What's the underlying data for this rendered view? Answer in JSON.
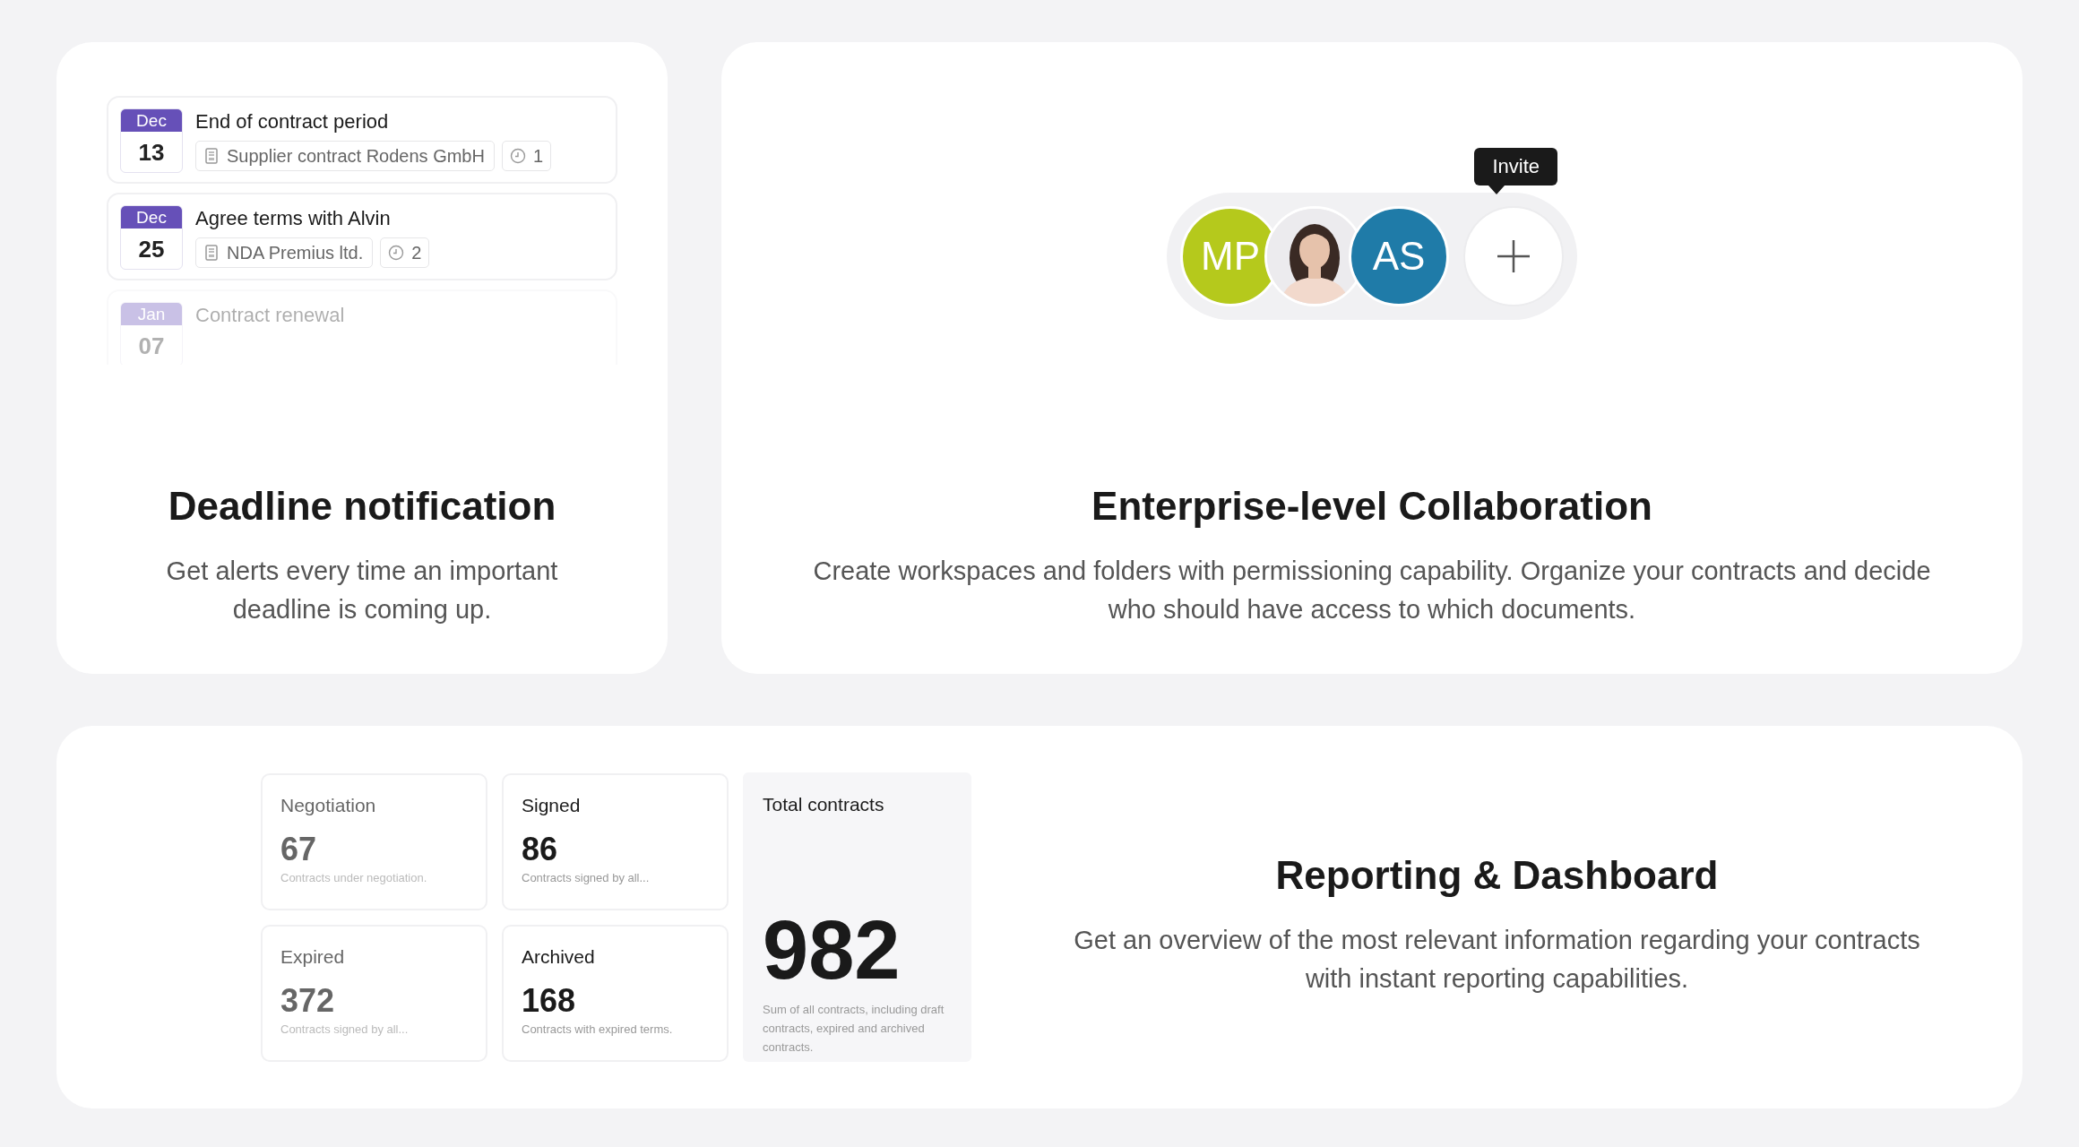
{
  "deadline_card": {
    "events": [
      {
        "month": "Dec",
        "day": "13",
        "title": "End of contract period",
        "document": "Supplier contract Rodens GmbH",
        "reminders": "1",
        "faded": false
      },
      {
        "month": "Dec",
        "day": "25",
        "title": "Agree terms with Alvin",
        "document": "NDA Premius ltd.",
        "reminders": "2",
        "faded": false
      },
      {
        "month": "Jan",
        "day": "07",
        "title": "Contract renewal",
        "faded": true
      }
    ],
    "title": "Deadline notification",
    "description": "Get alerts every time an important deadline is coming up."
  },
  "collaboration_card": {
    "avatars": [
      {
        "kind": "initials",
        "initials": "MP",
        "color": "#b5c91c"
      },
      {
        "kind": "picture"
      },
      {
        "kind": "initials",
        "initials": "AS",
        "color": "#1f7ba8"
      }
    ],
    "invite_tooltip": "Invite",
    "title": "Enterprise-level Collaboration",
    "description": "Create workspaces and folders with permissioning capability. Organize your contracts and decide who should have access to which documents."
  },
  "reporting_card": {
    "stats": [
      {
        "label": "Negotiation",
        "value": "67",
        "caption": "Contracts under negotiation.",
        "dimmed": true
      },
      {
        "label": "Signed",
        "value": "86",
        "caption": "Contracts signed by all...",
        "dimmed": false
      },
      {
        "label": "Expired",
        "value": "372",
        "caption": "Contracts signed by all...",
        "dimmed": true
      },
      {
        "label": "Archived",
        "value": "168",
        "caption": "Contracts with expired terms.",
        "dimmed": false
      }
    ],
    "total": {
      "label": "Total contracts",
      "value": "982",
      "caption": "Sum of all contracts, including draft contracts, expired and archived contracts."
    },
    "title": "Reporting & Dashboard",
    "description": "Get an overview of the most relevant information regarding your contracts with instant reporting capabilities."
  }
}
